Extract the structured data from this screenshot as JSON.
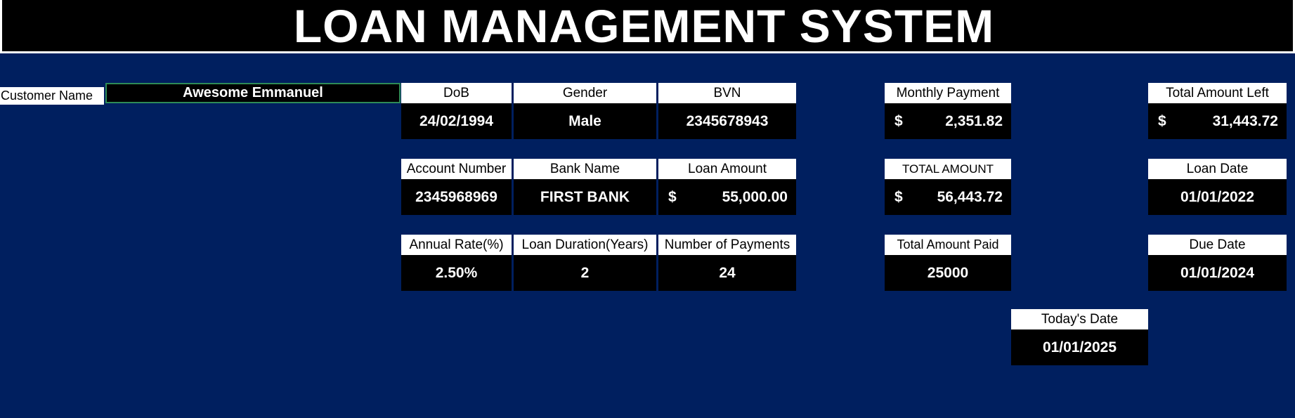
{
  "title": "LOAN MANAGEMENT SYSTEM",
  "customer": {
    "label": "Customer Name",
    "value": "Awesome Emmanuel"
  },
  "fields": {
    "dob": {
      "label": "DoB",
      "value": "24/02/1994"
    },
    "gender": {
      "label": "Gender",
      "value": "Male"
    },
    "bvn": {
      "label": "BVN",
      "value": "2345678943"
    },
    "account_number": {
      "label": "Account Number",
      "value": "2345968969"
    },
    "bank_name": {
      "label": "Bank Name",
      "value": "FIRST BANK"
    },
    "loan_amount": {
      "label": "Loan Amount",
      "currency": "$",
      "value": "55,000.00"
    },
    "annual_rate": {
      "label": "Annual Rate(%)",
      "value": "2.50%"
    },
    "loan_duration": {
      "label": "Loan Duration(Years)",
      "value": "2"
    },
    "num_payments": {
      "label": "Number of Payments",
      "value": "24"
    },
    "monthly_payment": {
      "label": "Monthly Payment",
      "currency": "$",
      "value": "2,351.82"
    },
    "total_amount": {
      "label": "TOTAL AMOUNT",
      "currency": "$",
      "value": "56,443.72"
    },
    "total_paid": {
      "label": "Total Amount Paid",
      "value": "25000"
    },
    "todays_date": {
      "label": "Today's Date",
      "value": "01/01/2025"
    },
    "total_left": {
      "label": "Total Amount Left",
      "currency": "$",
      "value": "31,443.72"
    },
    "loan_date": {
      "label": "Loan Date",
      "value": "01/01/2022"
    },
    "due_date": {
      "label": "Due Date",
      "value": "01/01/2024"
    }
  },
  "colors": {
    "background": "#001f5f",
    "title_bg": "#000000",
    "value_bg": "#000000",
    "label_bg": "#ffffff",
    "selection_border": "#2e8b57"
  },
  "icons": {
    "dropdown": "chevron-down-icon"
  }
}
